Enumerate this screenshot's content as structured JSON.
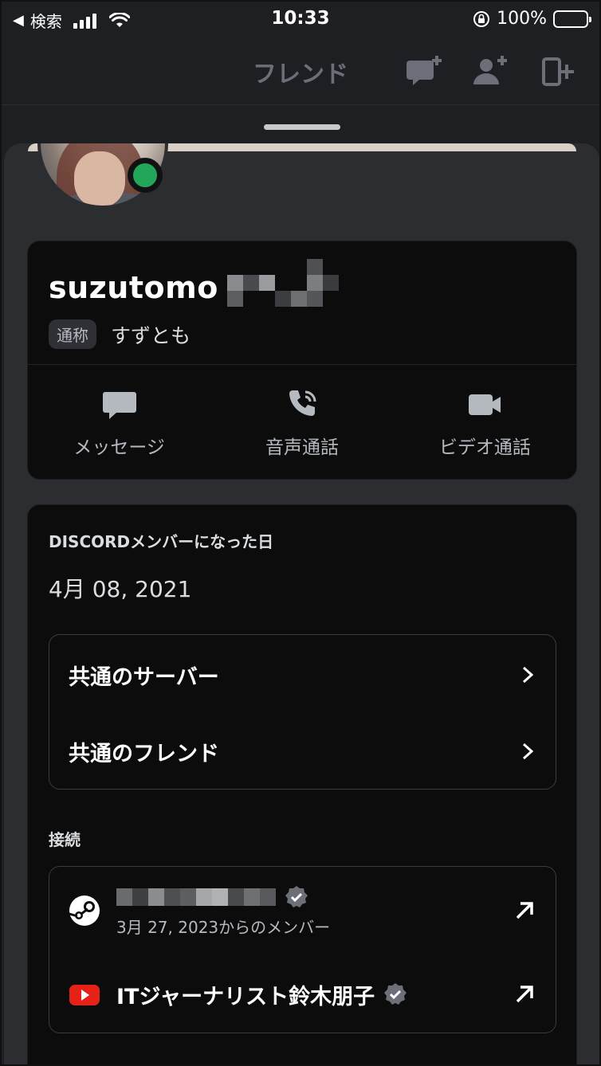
{
  "status_bar": {
    "back_label": "◀",
    "carrier": "検索",
    "time": "10:33",
    "battery": "100%"
  },
  "header": {
    "title": "フレンド",
    "icons": [
      "new-dm-icon",
      "add-friend-icon",
      "add-to-group-icon"
    ]
  },
  "profile": {
    "username": "suzutomo",
    "nickname_badge": "通称",
    "nickname": "すずとも",
    "status": "online"
  },
  "actions": [
    {
      "label": "メッセージ",
      "icon": "message-icon"
    },
    {
      "label": "音声通話",
      "icon": "voice-call-icon"
    },
    {
      "label": "ビデオ通話",
      "icon": "video-call-icon"
    }
  ],
  "member_since": {
    "title": "DISCORDメンバーになった日",
    "date": "4月 08, 2021"
  },
  "mutual": {
    "servers": "共通のサーバー",
    "friends": "共通のフレンド"
  },
  "connections": {
    "title": "接続",
    "steam": {
      "sub": "3月 27, 2023からのメンバー",
      "icon": "steam-icon"
    },
    "youtube": {
      "name": "ITジャーナリスト鈴木朋子",
      "icon": "youtube-icon"
    }
  },
  "colors": {
    "online": "#23a55a",
    "youtube": "#e62117",
    "accent_gray": "#6d6f78"
  }
}
